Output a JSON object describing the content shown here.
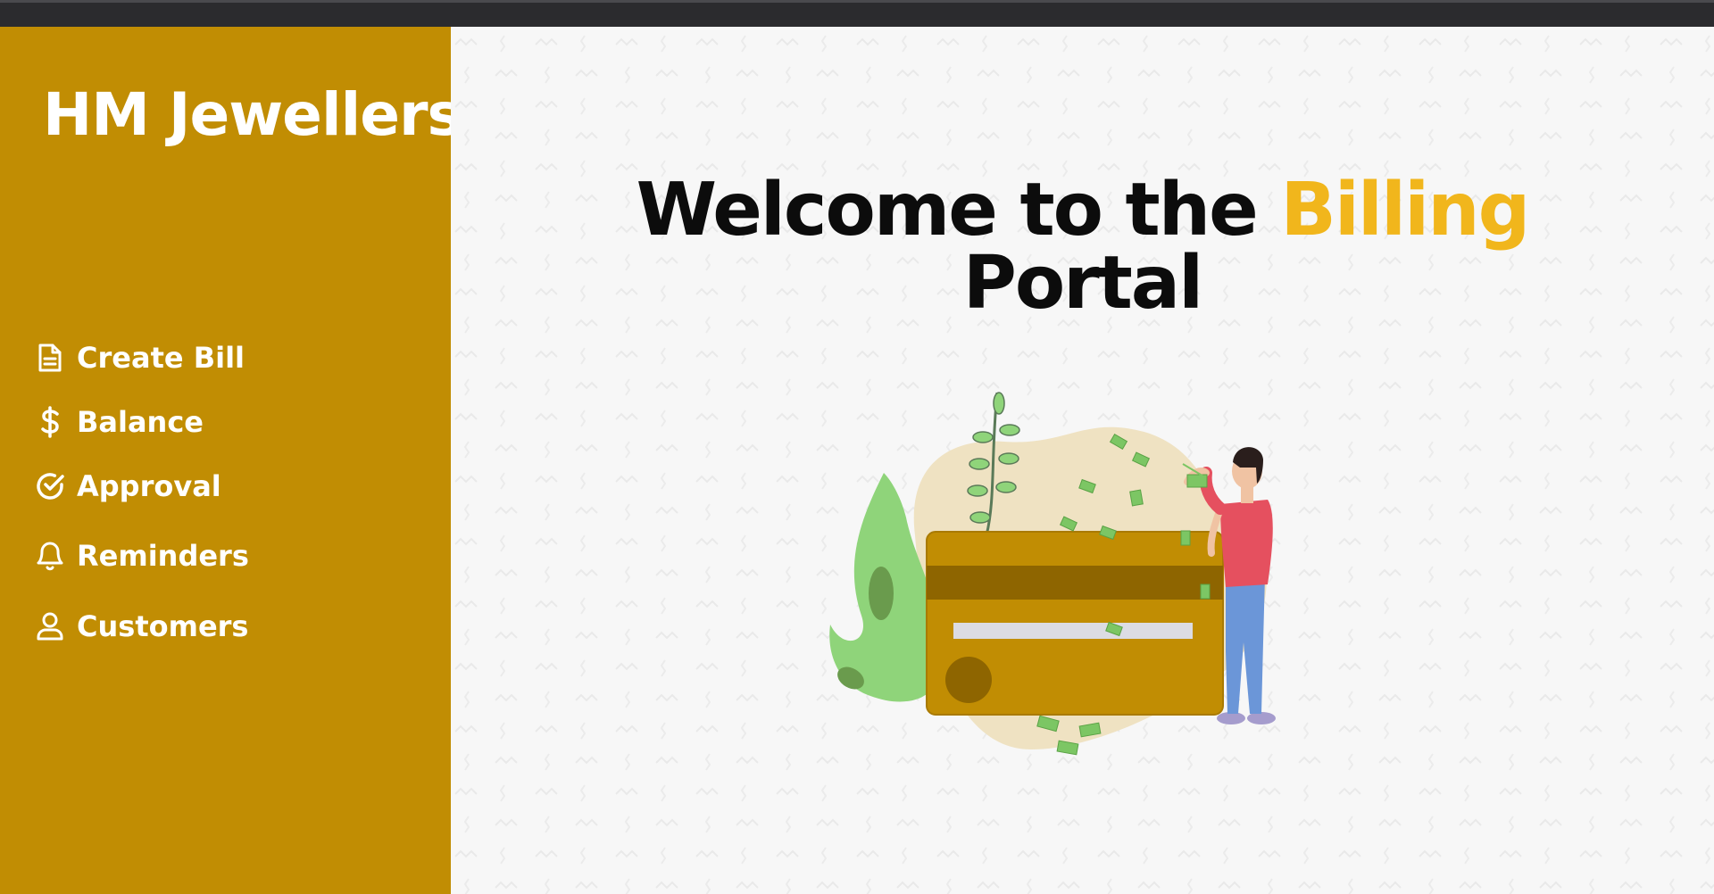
{
  "brand": {
    "name": "HM Jewellers"
  },
  "nav": {
    "items": [
      {
        "label": "Create Bill",
        "icon": "document-icon"
      },
      {
        "label": "Balance",
        "icon": "dollar-icon"
      },
      {
        "label": "Approval",
        "icon": "check-circle-icon"
      },
      {
        "label": "Reminders",
        "icon": "bell-icon"
      },
      {
        "label": "Customers",
        "icon": "user-icon"
      }
    ]
  },
  "main": {
    "heading_prefix": "Welcome to the",
    "heading_accent": "Billing",
    "heading_suffix": "Portal"
  },
  "colors": {
    "sidebar": "#c18d03",
    "accent": "#f1b61c",
    "background": "#f7f7f7",
    "topbar": "#2b2b2e"
  }
}
